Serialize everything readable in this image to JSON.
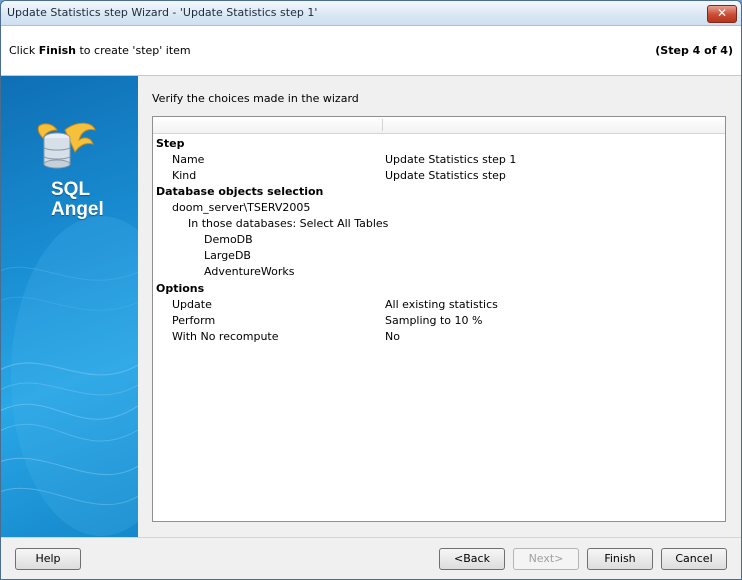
{
  "window": {
    "title": "Update Statistics step Wizard - 'Update Statistics step 1'",
    "close_symbol": "✕"
  },
  "header": {
    "hint_prefix": "Click ",
    "hint_bold": "Finish",
    "hint_suffix": " to create 'step' item",
    "step_indicator": "(Step 4 of 4)"
  },
  "sidebar": {
    "logo_line1": "SQL",
    "logo_line2": "Angel",
    "logo_icon": "database-with-wings-icon"
  },
  "main": {
    "verify_label": "Verify the choices made in the wizard",
    "rows": [
      {
        "label": "Step",
        "value": "",
        "section": true
      },
      {
        "label": "Name",
        "value": "Update Statistics step 1"
      },
      {
        "label": "Kind",
        "value": "Update Statistics step"
      },
      {
        "label": "Database objects selection",
        "value": "",
        "section": true
      },
      {
        "label": "doom_server\\TSERV2005",
        "value": ""
      },
      {
        "label": "In those databases: Select All Tables",
        "value": ""
      },
      {
        "label": "DemoDB",
        "value": ""
      },
      {
        "label": "LargeDB",
        "value": ""
      },
      {
        "label": "AdventureWorks",
        "value": ""
      },
      {
        "label": "Options",
        "value": "",
        "section": true
      },
      {
        "label": "Update",
        "value": "All existing statistics"
      },
      {
        "label": "Perform",
        "value": "Sampling to 10 %"
      },
      {
        "label": "With No recompute",
        "value": "No"
      }
    ]
  },
  "buttons": {
    "help": "Help",
    "back": "<Back",
    "next": "Next>",
    "finish": "Finish",
    "cancel": "Cancel"
  },
  "colors": {
    "sidebar_blue": "#1a8fd4",
    "close_red": "#c94a32"
  }
}
